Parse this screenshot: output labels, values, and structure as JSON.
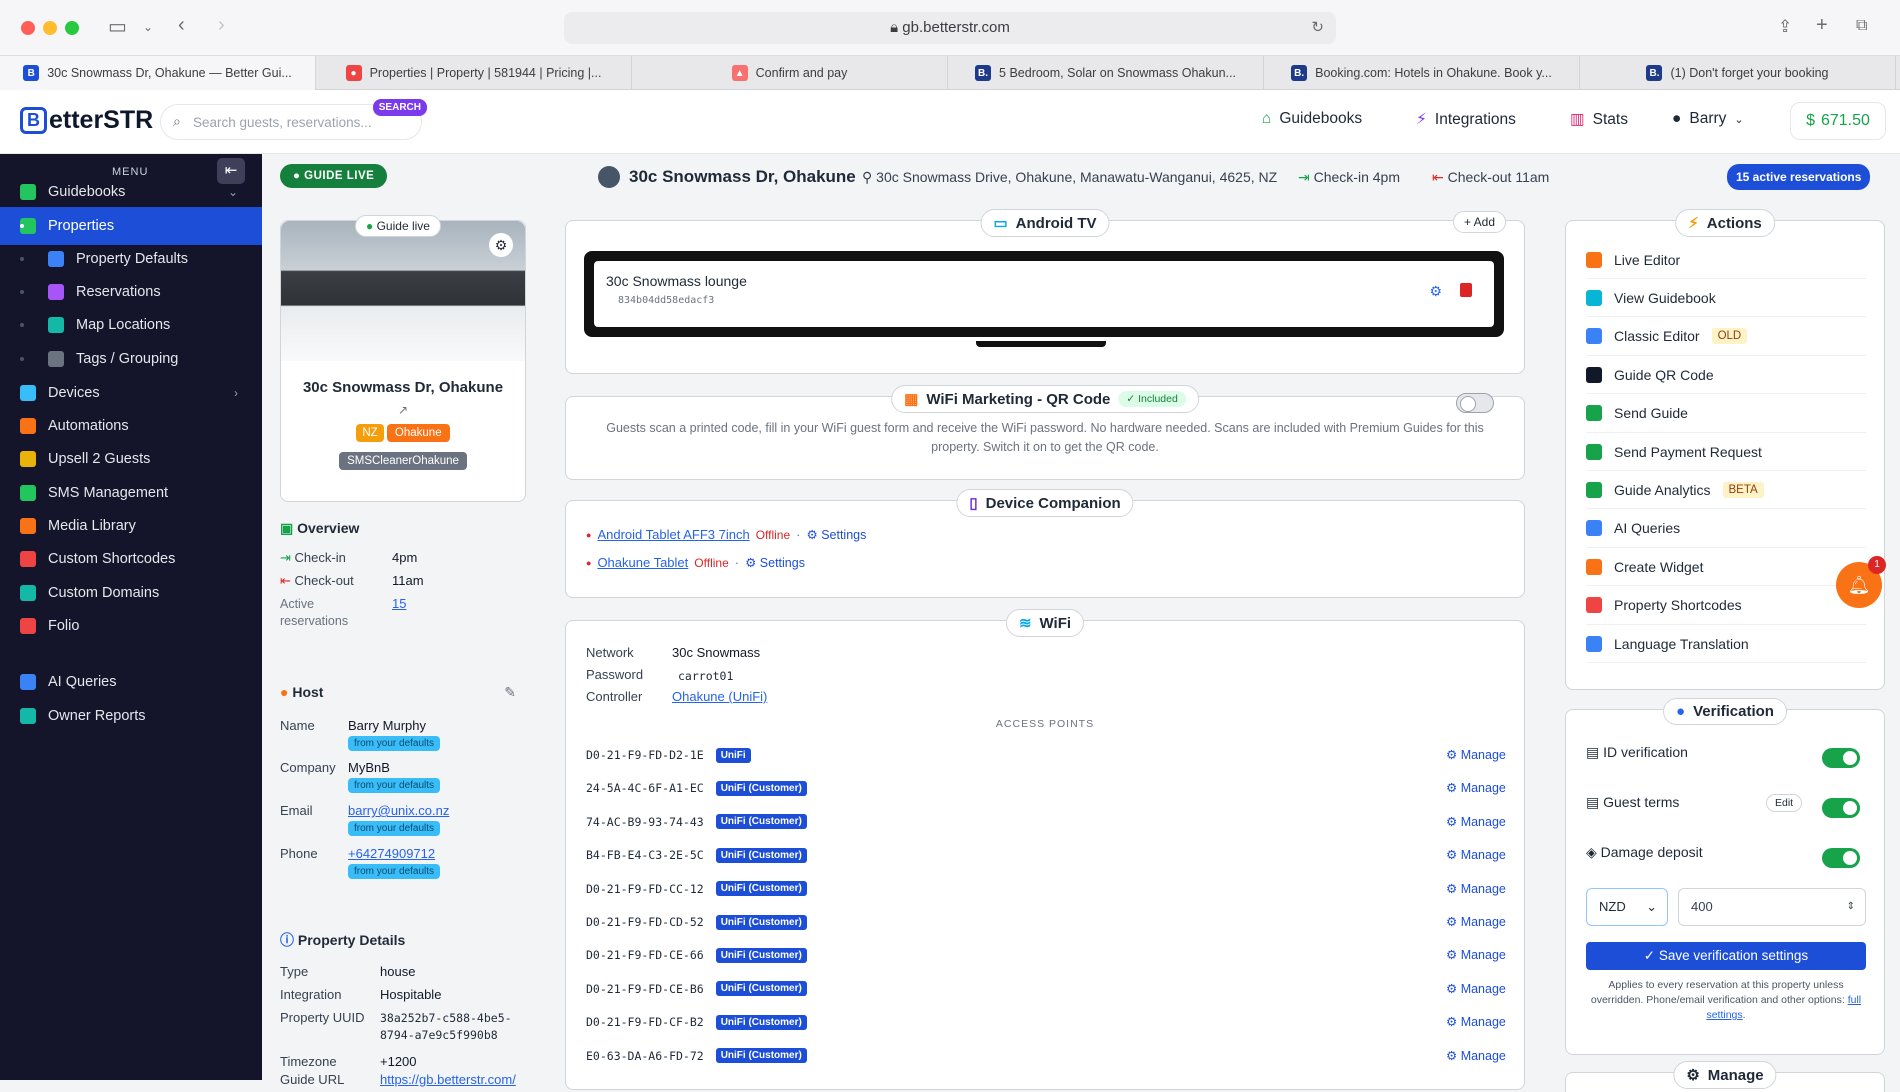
{
  "browser": {
    "url": "gb.betterstr.com",
    "tabs": [
      {
        "title": "30c Snowmass Dr, Ohakune — Better Gui...",
        "fav": "B",
        "color": "#1d4ed8"
      },
      {
        "title": "Properties | Property | 581944 | Pricing |...",
        "fav": "●",
        "color": "#ef4444"
      },
      {
        "title": "Confirm and pay",
        "fav": "▲",
        "color": "#f87171"
      },
      {
        "title": "5 Bedroom, Solar on Snowmass Ohakun...",
        "fav": "B.",
        "color": "#1e3a8a"
      },
      {
        "title": "Booking.com: Hotels in Ohakune. Book y...",
        "fav": "B.",
        "color": "#1e3a8a"
      },
      {
        "title": "(1) Don't forget your booking",
        "fav": "B.",
        "color": "#1e3a8a"
      }
    ]
  },
  "topnav": {
    "logo": "etterSTR",
    "logo_mark": "B",
    "search_placeholder": "Search guests, reservations...",
    "search_pill": "SEARCH",
    "guidebooks": "Guidebooks",
    "integrations": "Integrations",
    "stats": "Stats",
    "user": "Barry",
    "balance": "671.50"
  },
  "sidebar": {
    "menu_label": "MENU",
    "items": [
      {
        "label": "Guidebooks",
        "color": "#22c55e"
      },
      {
        "label": "Properties",
        "color": "#22c55e"
      },
      {
        "label": "Property Defaults",
        "color": "#3b82f6"
      },
      {
        "label": "Reservations",
        "color": "#a855f7"
      },
      {
        "label": "Map Locations",
        "color": "#14b8a6"
      },
      {
        "label": "Tags / Grouping",
        "color": "#6b7280"
      },
      {
        "label": "Devices",
        "color": "#38bdf8"
      },
      {
        "label": "Automations",
        "color": "#f97316"
      },
      {
        "label": "Upsell 2 Guests",
        "color": "#eab308"
      },
      {
        "label": "SMS Management",
        "color": "#22c55e"
      },
      {
        "label": "Media Library",
        "color": "#f97316"
      },
      {
        "label": "Custom Shortcodes",
        "color": "#ef4444"
      },
      {
        "label": "Custom Domains",
        "color": "#14b8a6"
      },
      {
        "label": "Folio",
        "color": "#ef4444"
      },
      {
        "label": "AI Queries",
        "color": "#3b82f6"
      },
      {
        "label": "Owner Reports",
        "color": "#14b8a6"
      }
    ]
  },
  "property": {
    "guide_live": "GUIDE LIVE",
    "title": "30c Snowmass Dr, Ohakune",
    "address": "30c Snowmass Drive, Ohakune, Manawatu-Wanganui, 4625, NZ",
    "checkin": "Check-in 4pm",
    "checkout": "Check-out 11am",
    "active_res": "15 active reservations",
    "card_badge": "Guide live",
    "name": "30c Snowmass Dr, Ohakune",
    "tag_nz": "NZ",
    "tag_ohakune": "Ohakune",
    "tag_cleaner": "SMSCleanerOhakune"
  },
  "overview": {
    "title": "Overview",
    "checkin_label": "Check-in",
    "checkin_value": "4pm",
    "checkout_label": "Check-out",
    "checkout_value": "11am",
    "active_label": "Active reservations",
    "active_value": "15"
  },
  "host": {
    "title": "Host",
    "name_label": "Name",
    "name": "Barry Murphy",
    "company_label": "Company",
    "company": "MyBnB",
    "email_label": "Email",
    "email": "barry@unix.co.nz",
    "phone_label": "Phone",
    "phone": "+64274909712",
    "defaults_chip": "from your defaults"
  },
  "details": {
    "title": "Property Details",
    "type_label": "Type",
    "type": "house",
    "integration_label": "Integration",
    "integration": "Hospitable",
    "uuid_label": "Property UUID",
    "uuid": "38a252b7-c588-4be5-8794-a7e9c5f990b8",
    "tz_label": "Timezone",
    "tz": "+1200",
    "guide_label": "Guide URL",
    "guide": "https://gb.betterstr.com/"
  },
  "android_tv": {
    "title": "Android TV",
    "add": "Add",
    "device_name": "30c Snowmass lounge",
    "device_id": "834b04dd58edacf3"
  },
  "wifi_marketing": {
    "title": "WiFi Marketing - QR Code",
    "badge": "Included",
    "text": "Guests scan a printed code, fill in your WiFi guest form and receive the WiFi password. No hardware needed. Scans are included with Premium Guides for this property. Switch it on to get the QR code."
  },
  "companion": {
    "title": "Device Companion",
    "devices": [
      {
        "name": "Android Tablet AFF3 7inch",
        "status": "Offline",
        "settings": "Settings"
      },
      {
        "name": "Ohakune Tablet",
        "status": "Offline",
        "settings": "Settings"
      }
    ]
  },
  "wifi": {
    "title": "WiFi",
    "network_label": "Network",
    "network": "30c Snowmass",
    "password_label": "Password",
    "password": "carrot01",
    "controller_label": "Controller",
    "controller": "Ohakune (UniFi)",
    "ap_header": "ACCESS POINTS",
    "manage": "Manage",
    "aps": [
      {
        "mac": "D0-21-F9-FD-D2-1E",
        "badge": "UniFi"
      },
      {
        "mac": "24-5A-4C-6F-A1-EC",
        "badge": "UniFi (Customer)"
      },
      {
        "mac": "74-AC-B9-93-74-43",
        "badge": "UniFi (Customer)"
      },
      {
        "mac": "B4-FB-E4-C3-2E-5C",
        "badge": "UniFi (Customer)"
      },
      {
        "mac": "D0-21-F9-FD-CC-12",
        "badge": "UniFi (Customer)"
      },
      {
        "mac": "D0-21-F9-FD-CD-52",
        "badge": "UniFi (Customer)"
      },
      {
        "mac": "D0-21-F9-FD-CE-66",
        "badge": "UniFi (Customer)"
      },
      {
        "mac": "D0-21-F9-FD-CE-B6",
        "badge": "UniFi (Customer)"
      },
      {
        "mac": "D0-21-F9-FD-CF-B2",
        "badge": "UniFi (Customer)"
      },
      {
        "mac": "E0-63-DA-A6-FD-72",
        "badge": "UniFi (Customer)"
      }
    ]
  },
  "actions": {
    "title": "Actions",
    "items": [
      {
        "label": "Live Editor",
        "color": "#f97316",
        "tag": ""
      },
      {
        "label": "View Guidebook",
        "color": "#06b6d4",
        "tag": ""
      },
      {
        "label": "Classic Editor",
        "color": "#3b82f6",
        "tag": "OLD"
      },
      {
        "label": "Guide QR Code",
        "color": "#111827",
        "tag": ""
      },
      {
        "label": "Send Guide",
        "color": "#16a34a",
        "tag": ""
      },
      {
        "label": "Send Payment Request",
        "color": "#16a34a",
        "tag": ""
      },
      {
        "label": "Guide Analytics",
        "color": "#16a34a",
        "tag": "BETA"
      },
      {
        "label": "AI Queries",
        "color": "#3b82f6",
        "tag": ""
      },
      {
        "label": "Create Widget",
        "color": "#f97316",
        "tag": ""
      },
      {
        "label": "Property Shortcodes",
        "color": "#ef4444",
        "tag": ""
      },
      {
        "label": "Language Translation",
        "color": "#3b82f6",
        "tag": ""
      }
    ]
  },
  "verification": {
    "title": "Verification",
    "id_label": "ID verification",
    "terms_label": "Guest terms",
    "edit": "Edit",
    "deposit_label": "Damage deposit",
    "currency": "NZD",
    "amount": "400",
    "save": "Save verification settings",
    "note": "Applies to every reservation at this property unless overridden. Phone/email verification and other options:",
    "note_link": "full settings",
    "manage_title": "Manage"
  },
  "notifications": {
    "count": "1"
  }
}
